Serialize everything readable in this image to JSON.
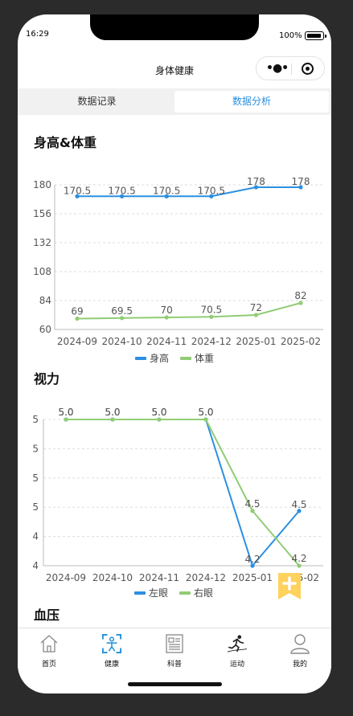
{
  "status_bar": {
    "time": "16:29",
    "battery": "100%"
  },
  "nav": {
    "title": "身体健康"
  },
  "tabs": [
    {
      "label": "数据记录",
      "active": false
    },
    {
      "label": "数据分析",
      "active": true
    }
  ],
  "sections": {
    "height_weight": "身高&体重",
    "vision": "视力",
    "blood_pressure": "血压"
  },
  "chart_data": [
    {
      "type": "line",
      "title": "身高&体重",
      "categories": [
        "2024-09",
        "2024-10",
        "2024-11",
        "2024-12",
        "2025-01",
        "2025-02"
      ],
      "series": [
        {
          "name": "身高",
          "color": "#2b8fe3",
          "values": [
            170.5,
            170.5,
            170.5,
            170.5,
            178,
            178
          ]
        },
        {
          "name": "体重",
          "color": "#91cc75",
          "values": [
            69,
            69.5,
            70,
            70.5,
            72,
            82
          ]
        }
      ],
      "yticks": [
        60,
        84,
        108,
        132,
        156,
        180
      ],
      "ylim": [
        60,
        180
      ],
      "grid": true,
      "legend": "bottom"
    },
    {
      "type": "line",
      "title": "视力",
      "categories": [
        "2024-09",
        "2024-10",
        "2024-11",
        "2024-12",
        "2025-01",
        "2025-02"
      ],
      "series": [
        {
          "name": "左眼",
          "color": "#2b8fe3",
          "values": [
            5.0,
            5.0,
            5.0,
            5.0,
            4.2,
            4.5
          ]
        },
        {
          "name": "右眼",
          "color": "#91cc75",
          "values": [
            5.0,
            5.0,
            5.0,
            5.0,
            4.5,
            4.2
          ]
        }
      ],
      "yticks": [
        "4",
        "4",
        "5",
        "5",
        "5",
        "5"
      ],
      "ylim": [
        4.2,
        5.0
      ],
      "grid": true,
      "legend": "bottom"
    }
  ],
  "tabbar": [
    {
      "label": "首页",
      "icon": "home-icon"
    },
    {
      "label": "健康",
      "icon": "health-scan-icon",
      "active": true
    },
    {
      "label": "科普",
      "icon": "newspaper-icon"
    },
    {
      "label": "运动",
      "icon": "running-icon"
    },
    {
      "label": "我的",
      "icon": "user-icon"
    }
  ],
  "fab": {
    "icon": "plus-icon",
    "color": "#ffd25e"
  }
}
